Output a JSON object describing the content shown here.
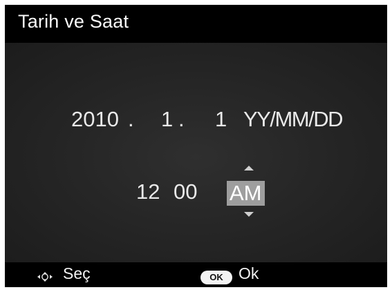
{
  "title": "Tarih ve Saat",
  "date": {
    "year": "2010",
    "sep1": ".",
    "month": "1",
    "sep2": ".",
    "day": "1",
    "format": "YY/MM/DD"
  },
  "time": {
    "hour": "12",
    "minute": "00",
    "ampm": "AM"
  },
  "footer": {
    "select_icon": "dpad-icon",
    "select_label": "Seç",
    "ok_badge": "OK",
    "ok_label": "Ok"
  },
  "colors": {
    "background": "#000000",
    "content_bg": "#262626",
    "highlight": "#9e9e9e",
    "text": "#e9e9e9"
  }
}
